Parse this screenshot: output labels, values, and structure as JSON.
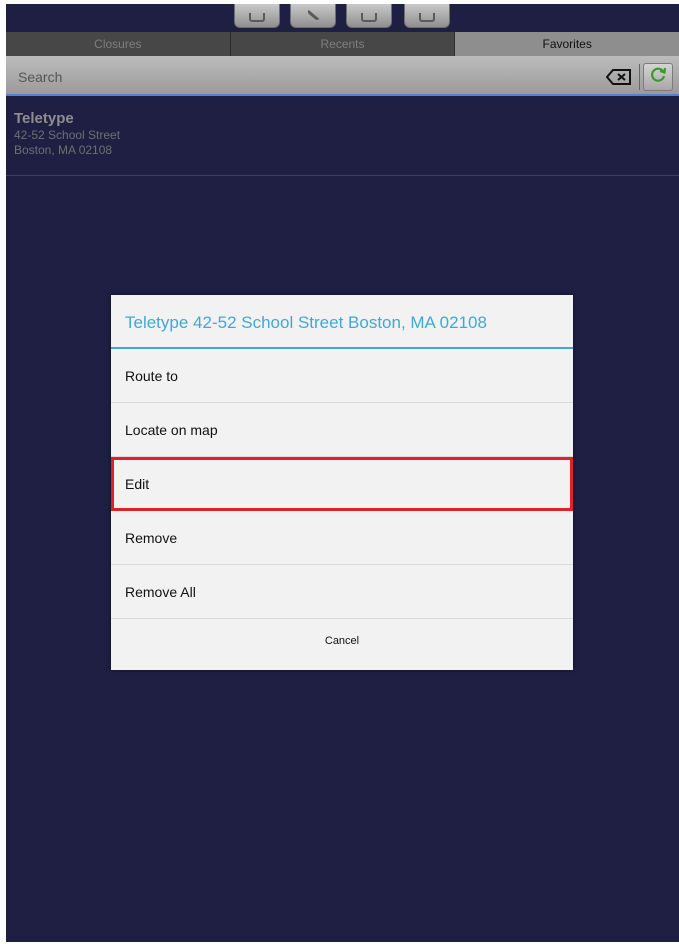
{
  "tabs": [
    {
      "label": "Closures",
      "active": false
    },
    {
      "label": "Recents",
      "active": false
    },
    {
      "label": "Favorites",
      "active": true
    }
  ],
  "search": {
    "placeholder": "Search",
    "value": ""
  },
  "favorites": [
    {
      "name": "Teletype",
      "address_line1": "42-52 School Street",
      "address_line2": "Boston, MA 02108"
    }
  ],
  "dialog": {
    "title": "Teletype 42-52 School Street Boston, MA 02108",
    "options": [
      "Route to",
      "Locate on map",
      "Edit",
      "Remove",
      "Remove All"
    ],
    "highlighted_option": "Edit",
    "cancel_label": "Cancel"
  },
  "colors": {
    "background": "#1f1f44",
    "accent": "#3fa9d4",
    "highlight": "#e0202a",
    "refresh": "#3c9a2a"
  },
  "icons": {
    "toolbar": [
      "toolbar-button-1-icon",
      "toolbar-button-2-icon",
      "toolbar-button-3-icon",
      "toolbar-button-4-icon"
    ],
    "clear": "backspace-clear-icon",
    "refresh": "refresh-icon"
  }
}
